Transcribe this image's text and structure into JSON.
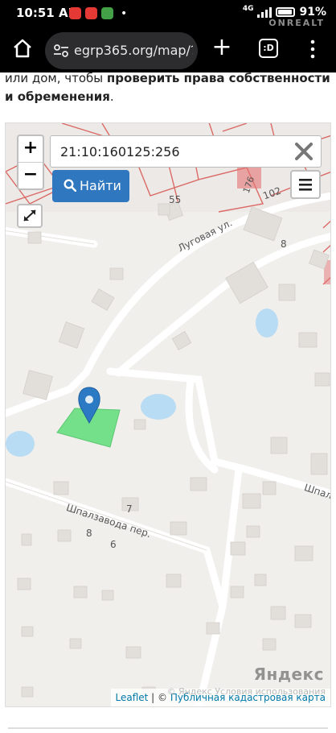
{
  "status_bar": {
    "time": "10:51 AM",
    "separator_dot": "•",
    "network_type": "4G",
    "battery": "91%",
    "watermark": "ONREALT",
    "app_icon_colors": [
      "#e53935",
      "#e53935",
      "#43a047"
    ]
  },
  "browser": {
    "url": "egrp365.org/map/?ka",
    "tabs_label": ":D",
    "newtab_label": "+",
    "menu_label": "⋮"
  },
  "intro": {
    "part_plain": "или дом, чтобы ",
    "part_bold": "проверить права собственности и обременения",
    "part_end": "."
  },
  "map": {
    "zoom_in": "+",
    "zoom_out": "−",
    "search_value": "21:10:160125:256",
    "find_label": "Найти",
    "street_labels": {
      "lugovaya": "Луговая ул.",
      "shpalzavoda": "Шпалзавода пер.",
      "shpalz_right": "Шпалз"
    },
    "house_numbers": {
      "n55": "55",
      "n102": "102",
      "n176": "176",
      "n8_top": "8",
      "n7": "7",
      "n8_bottom": "8",
      "n6": "6"
    },
    "yandex_logo": "Яндекс",
    "attribution": {
      "leaflet": "Leaflet",
      "separator": " | © ",
      "cadastral": "Публичная кадастровая карта",
      "yandex_terms": "© Яндекс  Условия использования"
    },
    "colors": {
      "parcel": "#74e08a",
      "cadastral_lines": "#d9534f",
      "water": "#b7dcf3",
      "marker": "#2c7ac3",
      "button": "#2f78bf"
    }
  }
}
